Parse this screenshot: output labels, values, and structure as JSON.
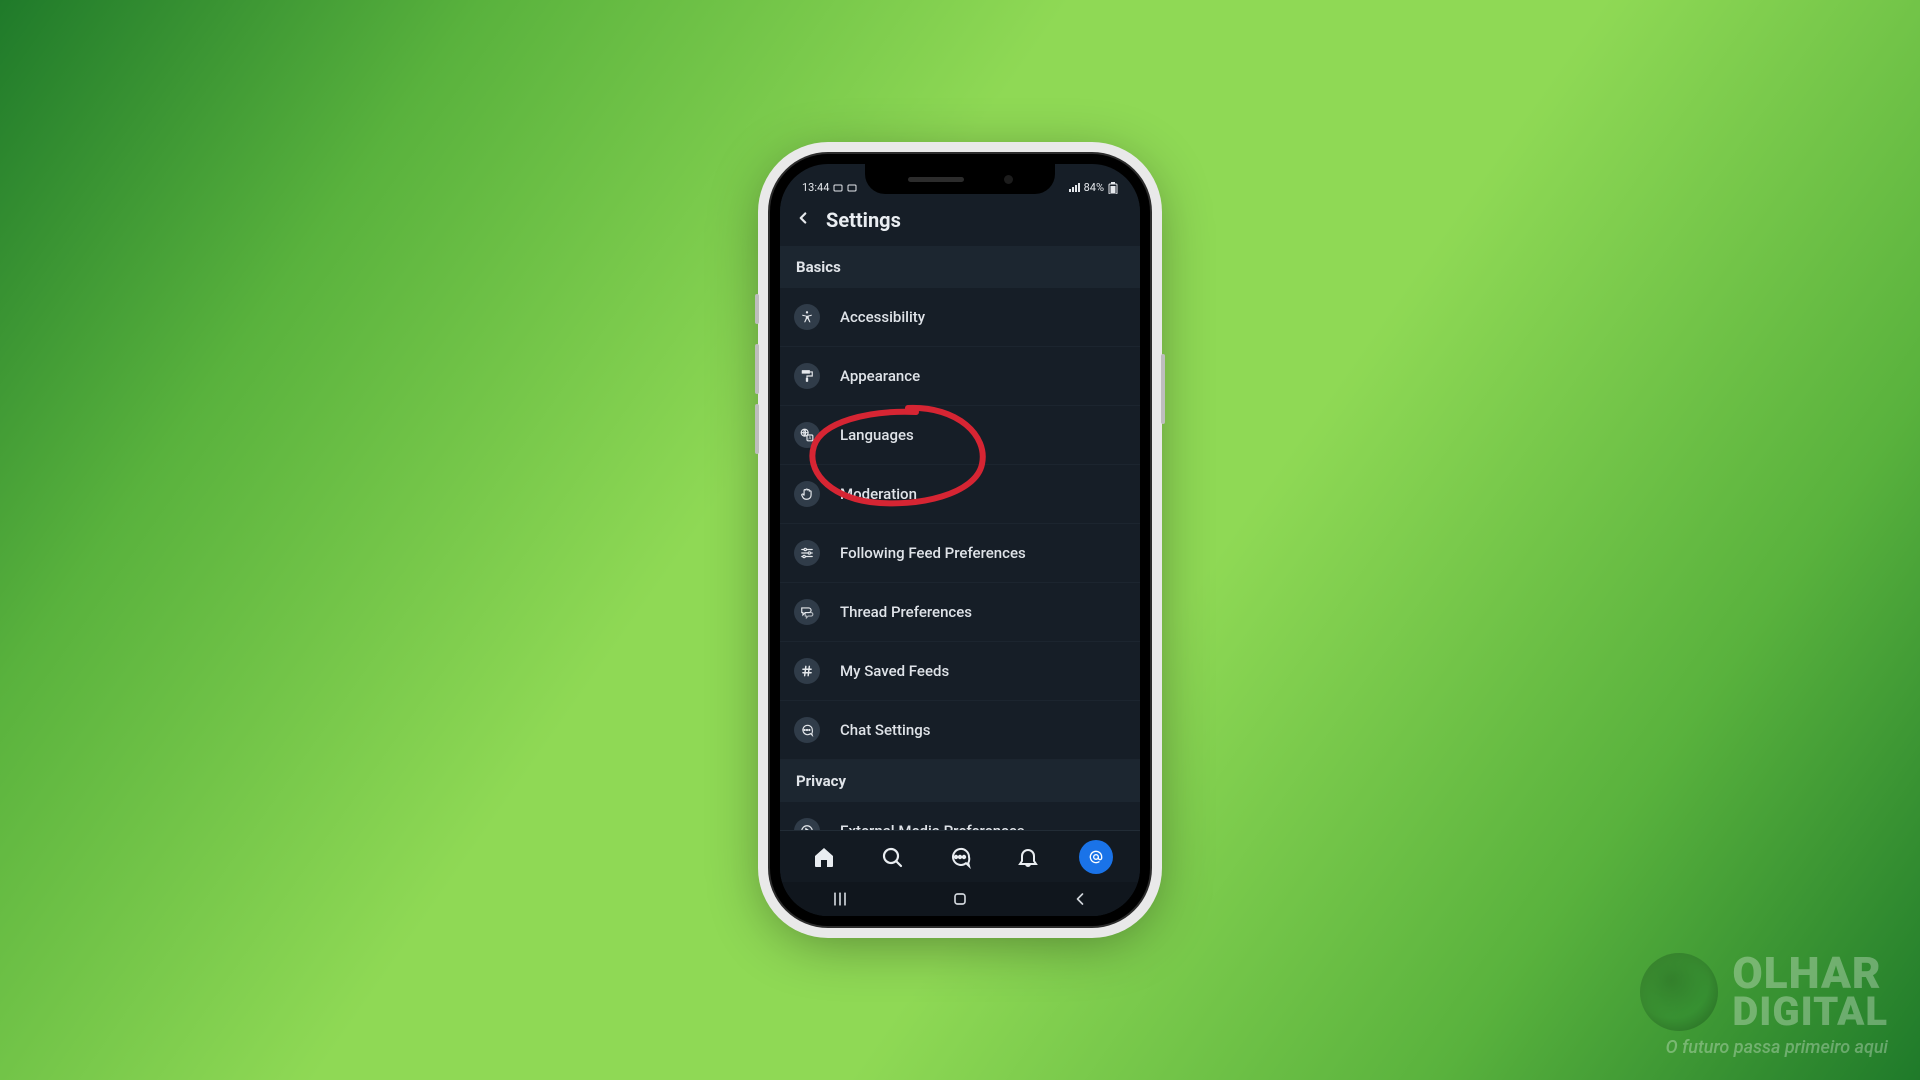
{
  "status_bar": {
    "time": "13:44",
    "battery_pct": "84%"
  },
  "header": {
    "title": "Settings"
  },
  "sections": [
    {
      "title": "Basics",
      "items": [
        {
          "label": "Accessibility",
          "icon": "accessibility-icon"
        },
        {
          "label": "Appearance",
          "icon": "paint-roller-icon"
        },
        {
          "label": "Languages",
          "icon": "globe-translate-icon",
          "highlighted": true
        },
        {
          "label": "Moderation",
          "icon": "hand-icon"
        },
        {
          "label": "Following Feed Preferences",
          "icon": "sliders-icon"
        },
        {
          "label": "Thread Preferences",
          "icon": "thread-icon"
        },
        {
          "label": "My Saved Feeds",
          "icon": "hash-icon"
        },
        {
          "label": "Chat Settings",
          "icon": "chat-bubble-icon"
        }
      ]
    },
    {
      "title": "Privacy",
      "items": [
        {
          "label": "External Media Preferences",
          "icon": "play-circle-icon"
        }
      ]
    }
  ],
  "tabbar": {
    "items": [
      {
        "name": "home-tab",
        "icon": "home-icon"
      },
      {
        "name": "search-tab",
        "icon": "search-icon"
      },
      {
        "name": "chat-tab",
        "icon": "chat-icon"
      },
      {
        "name": "notifications-tab",
        "icon": "bell-icon"
      },
      {
        "name": "profile-tab",
        "icon": "at-icon",
        "active": true
      }
    ]
  },
  "watermark": {
    "line1": "OLHAR",
    "line2": "DIGITAL",
    "tagline": "O futuro passa primeiro aqui"
  },
  "annotation": {
    "type": "red-ellipse",
    "target_label": "Languages",
    "color": "#d62533"
  }
}
